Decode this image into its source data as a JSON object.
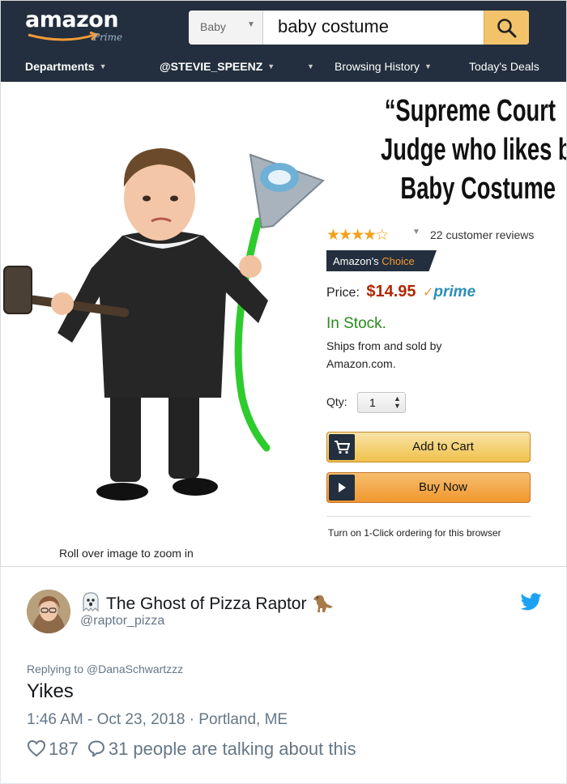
{
  "amazon": {
    "logo": {
      "word": "amazon",
      "sub": "Prime"
    },
    "search": {
      "category": "Baby",
      "query": "baby costume"
    },
    "nav": {
      "departments": "Departments",
      "account": "@STEVIE_SPEENZ",
      "history": "Browsing History",
      "deals": "Today's Deals"
    },
    "product": {
      "title_lines": [
        "“Supreme Court",
        "Judge who likes beer”",
        "Baby Costume"
      ],
      "stars": "★★★★☆",
      "rating_value": 4,
      "reviews": "22 customer reviews",
      "badge_a": "Amazon's",
      "badge_b": "Choice",
      "price_label": "Price:",
      "price": "$14.95",
      "prime_check": "✓",
      "prime_word": "prime",
      "stock": "In Stock.",
      "ships_line1": "Ships from and sold by",
      "ships_line2": "Amazon.com.",
      "qty_label": "Qty:",
      "qty_value": "1",
      "add_to_cart": "Add to Cart",
      "buy_now": "Buy Now",
      "one_click": "Turn on 1-Click ordering for this browser",
      "zoom_hint": "Roll over image to zoom in"
    },
    "colors": {
      "header_bg": "#232f3e",
      "price": "#b12704",
      "stock": "#2a8a1f",
      "stars": "#f0a11c",
      "prime": "#2c8fb6",
      "cart_button": "#f0c14b",
      "buy_button": "#f0972e"
    }
  },
  "tweet": {
    "author_name": "The Ghost of Pizza Raptor",
    "handle": "@raptor_pizza",
    "replying_to": "Replying to @DanaSchwartzzz",
    "text": "Yikes",
    "meta": "1:46 AM - Oct 23, 2018 · Portland, ME",
    "likes": "187",
    "talking": "31 people are talking about this",
    "icons": [
      "ghost-icon",
      "raptor-icon",
      "twitter-bird-icon",
      "heart-icon",
      "speech-bubble-icon"
    ],
    "colors": {
      "name": "#14171a",
      "muted": "#657786",
      "bird": "#1da1f2"
    }
  }
}
